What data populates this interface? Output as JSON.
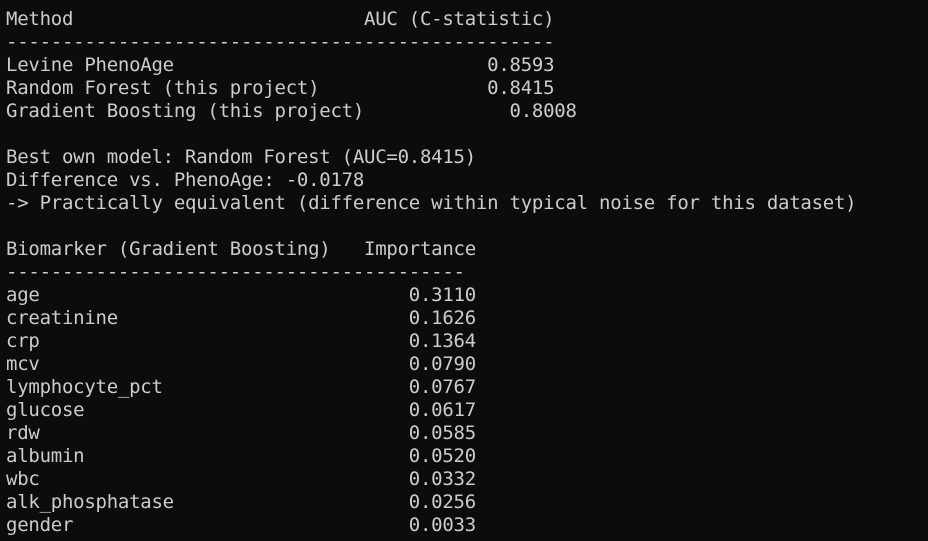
{
  "colors": {
    "background": "#0c0c0c",
    "foreground": "#cccccc"
  },
  "terminal": {
    "lines": [
      "Method                          AUC (C-statistic)",
      "-------------------------------------------------",
      "Levine PhenoAge                            0.8593",
      "Random Forest (this project)               0.8415",
      "Gradient Boosting (this project)             0.8008",
      "",
      "Best own model: Random Forest (AUC=0.8415)",
      "Difference vs. PhenoAge: -0.0178",
      "-> Practically equivalent (difference within typical noise for this dataset)",
      "",
      "Biomarker (Gradient Boosting)   Importance",
      "-----------------------------------------",
      "age                                 0.3110",
      "creatinine                          0.1626",
      "crp                                 0.1364",
      "mcv                                 0.0790",
      "lymphocyte_pct                      0.0767",
      "glucose                             0.0617",
      "rdw                                 0.0585",
      "albumin                             0.0520",
      "wbc                                 0.0332",
      "alk_phosphatase                     0.0256",
      "gender                              0.0033"
    ]
  }
}
